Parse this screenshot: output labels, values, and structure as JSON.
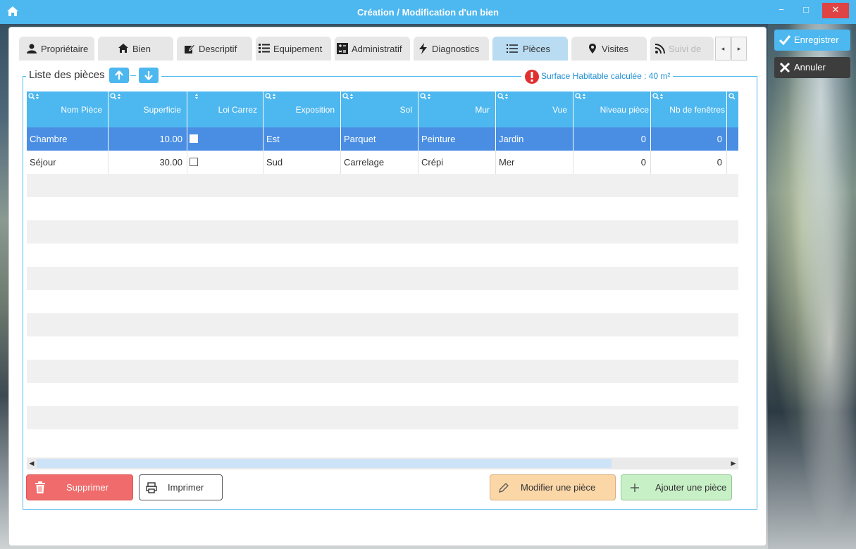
{
  "window": {
    "title": "Création / Modification d'un bien",
    "minimize": "−",
    "maximize": "□",
    "close": "✕"
  },
  "actions": {
    "save_label": "Enregistrer",
    "cancel_label": "Annuler"
  },
  "tabs": [
    {
      "label": "Propriétaire",
      "icon": "user-icon"
    },
    {
      "label": "Bien",
      "icon": "home-icon"
    },
    {
      "label": "Descriptif",
      "icon": "edit-icon"
    },
    {
      "label": "Equipement",
      "icon": "list-icon"
    },
    {
      "label": "Administratif",
      "icon": "calculator-icon"
    },
    {
      "label": "Diagnostics",
      "icon": "bolt-icon"
    },
    {
      "label": "Pièces",
      "icon": "list-icon",
      "active": true
    },
    {
      "label": "Visites",
      "icon": "map-marker-icon"
    },
    {
      "label": "Suivi de",
      "icon": "rss-icon"
    }
  ],
  "tab_scroll": {
    "left": "◂",
    "right": "▸"
  },
  "group": {
    "title": "Liste des pièces",
    "surface_text": "Surface Habitable calculée : 40 m²"
  },
  "grid": {
    "columns": [
      "Nom Pièce",
      "Superficie",
      "Loi Carrez",
      "Exposition",
      "Sol",
      "Mur",
      "Vue",
      "Niveau pièce",
      "Nb de fenêtres"
    ],
    "rows": [
      {
        "nom": "Chambre",
        "superficie": "10.00",
        "loi_carrez": false,
        "exposition": "Est",
        "sol": "Parquet",
        "mur": "Peinture",
        "vue": "Jardin",
        "niveau": "0",
        "fenetres": "0",
        "selected": true
      },
      {
        "nom": "Séjour",
        "superficie": "30.00",
        "loi_carrez": false,
        "exposition": "Sud",
        "sol": "Carrelage",
        "mur": "Crépi",
        "vue": "Mer",
        "niveau": "0",
        "fenetres": "0",
        "selected": false
      }
    ]
  },
  "buttons": {
    "delete": "Supprimer",
    "print": "Imprimer",
    "modify": "Modifier une pièce",
    "add": "Ajouter une pièce"
  },
  "colors": {
    "accent": "#4db7ef",
    "selected_row": "#4a8ee3",
    "delete": "#f06b6b",
    "modify": "#fbd7a8",
    "add": "#c8f0c6"
  }
}
